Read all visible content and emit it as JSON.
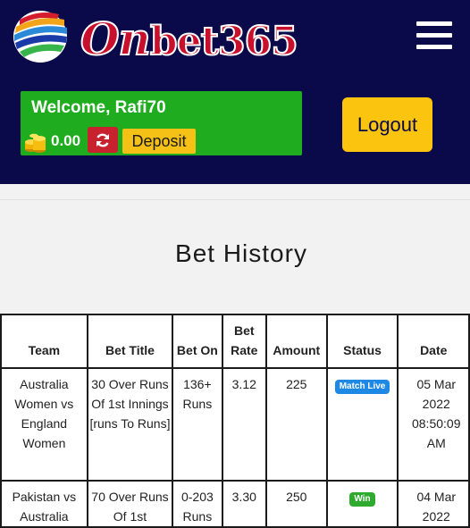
{
  "colors": {
    "header_bg": "#0a0a4a",
    "welcome_bg": "#1fad1f",
    "refresh_bg": "#c8222e",
    "deposit_bg": "#f5c116",
    "logout_bg": "#fbc40e",
    "badge_live": "#1e88e5",
    "badge_win": "#2eaa2e"
  },
  "header": {
    "logo_first": "On",
    "logo_rest": "bet365",
    "logo_icon": "striped-ball-logo",
    "menu_icon": "hamburger-menu-icon"
  },
  "account": {
    "welcome": "Welcome, Rafi70",
    "balance": "0.00",
    "coins_icon": "gold-coins-icon",
    "refresh_icon": "refresh-icon",
    "deposit_label": "Deposit",
    "logout_label": "Logout"
  },
  "page": {
    "title": "Bet History"
  },
  "table": {
    "headers": {
      "team": "Team",
      "title": "Bet Title",
      "on": "Bet On",
      "rate": "Bet Rate",
      "amount": "Amount",
      "status": "Status",
      "date": "Date"
    },
    "rows": [
      {
        "team": "Australia Women vs England Women",
        "title": "30 Over Runs Of 1st Innings [runs To Runs]",
        "on": "136+ Runs",
        "rate": "3.12",
        "amount": "225",
        "status": "Match Live",
        "date": "05 Mar 2022 08:50:09 AM"
      },
      {
        "team": "Pakistan vs Australia",
        "title": "70 Over Runs Of 1st",
        "on": "0-203 Runs",
        "rate": "3.30",
        "amount": "250",
        "status": "Win",
        "date": "04 Mar 2022"
      }
    ]
  }
}
